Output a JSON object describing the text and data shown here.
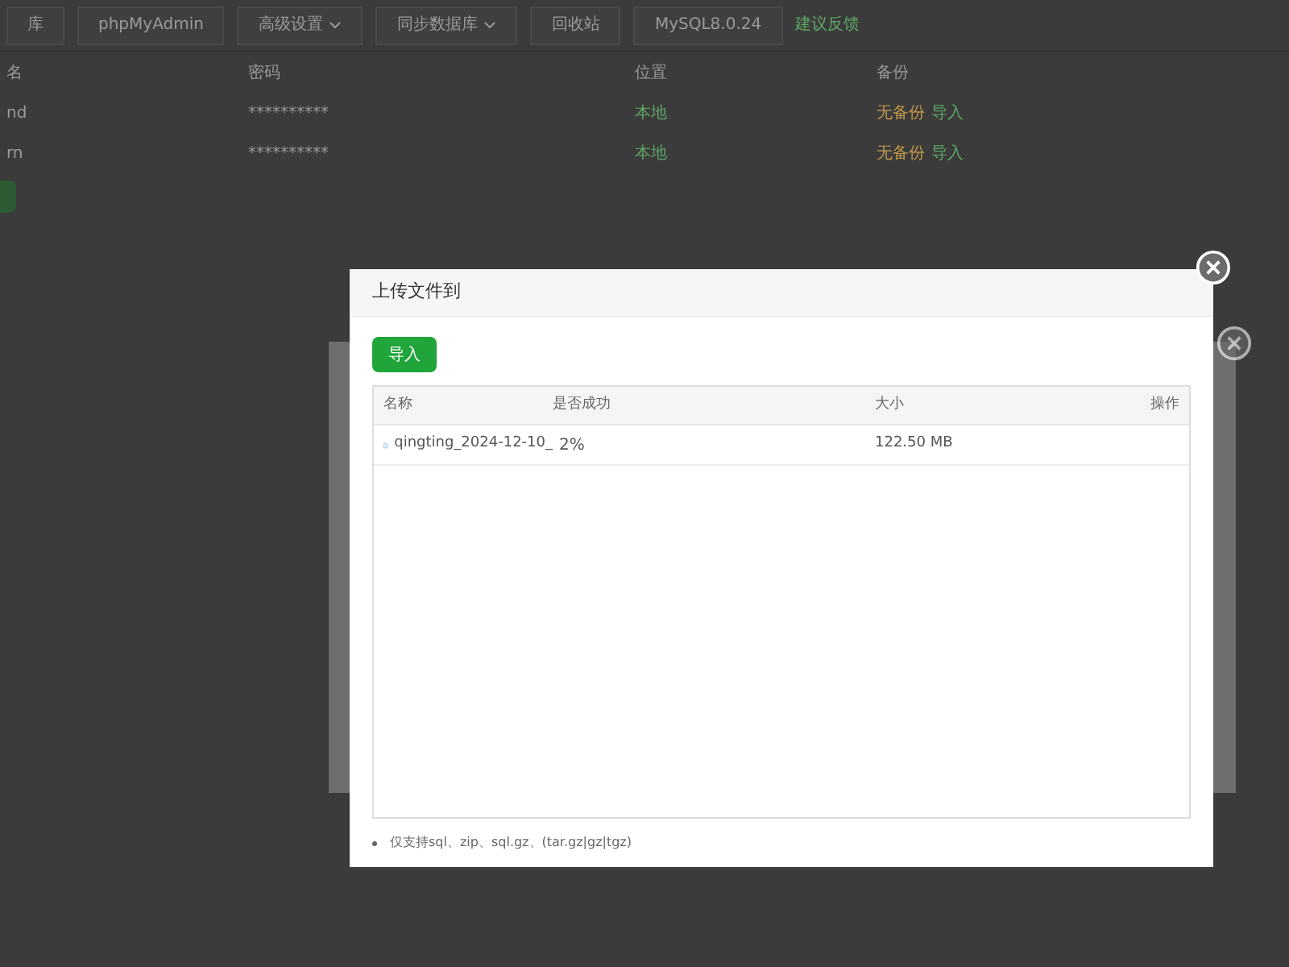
{
  "toolbar": {
    "buttons": [
      {
        "label": "库",
        "dropdown": false
      },
      {
        "label": "phpMyAdmin",
        "dropdown": false
      },
      {
        "label": "高级设置",
        "dropdown": true
      },
      {
        "label": "同步数据库",
        "dropdown": true
      },
      {
        "label": "回收站",
        "dropdown": false
      },
      {
        "label": "MySQL8.0.24",
        "dropdown": false
      }
    ],
    "link": "建议反馈"
  },
  "table": {
    "columns": [
      "名",
      "密码",
      "位置",
      "备份"
    ],
    "rows": [
      {
        "name": "nd",
        "password": "**********",
        "location": "本地",
        "backup": "无备份",
        "action": "导入"
      },
      {
        "name": "rn",
        "password": "**********",
        "location": "本地",
        "backup": "无备份",
        "action": "导入"
      }
    ]
  },
  "dialog": {
    "title": "上传文件到",
    "import_button": "导入",
    "columns": [
      "名称",
      "是否成功",
      "大小",
      "操作"
    ],
    "files": [
      {
        "name": "qingting_2024-12-10_",
        "status": "2%",
        "size": "122.50 MB"
      }
    ],
    "note": "仅支持sql、zip、sql.gz、(tar.gz|gz|tgz)"
  }
}
